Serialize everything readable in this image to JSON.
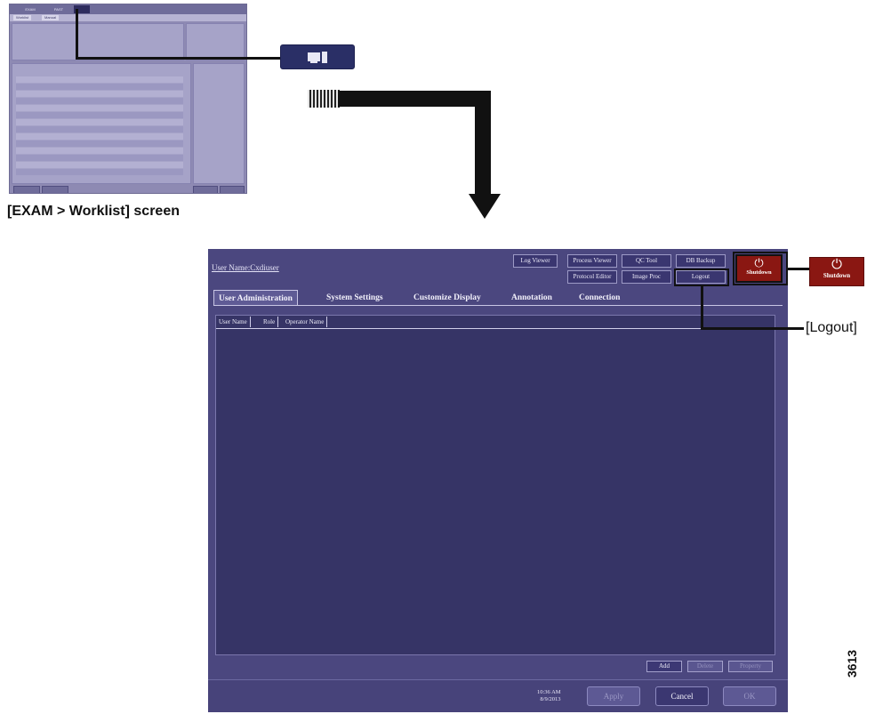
{
  "thumbnail": {
    "tabs": [
      "EXAM",
      "PAST",
      ""
    ],
    "subtabs": [
      "Worklist",
      "Manual"
    ]
  },
  "caption": "[EXAM > Worklist] screen",
  "window": {
    "user_name": "User Name:Cxdiuser",
    "tool_buttons": {
      "log_viewer": "Log Viewer",
      "process_viewer": "Process Viewer",
      "qc_tool": "QC Tool",
      "db_backup": "DB Backup",
      "protocol_editor": "Protocol Editor",
      "image_proc": "Image Proc",
      "logout": "Logout",
      "shutdown": "Shutdown"
    },
    "tabs": [
      "User Administration",
      "System Settings",
      "Customize Display",
      "Annotation",
      "Connection"
    ],
    "active_tab": "User Administration",
    "table": {
      "columns": [
        "User Name",
        "Role",
        "Operator Name"
      ],
      "rows": []
    },
    "grid_buttons": {
      "add": "Add",
      "delete": "Delete",
      "property": "Property"
    },
    "clock": {
      "time": "10:36 AM",
      "date": "8/9/2013"
    },
    "footer_buttons": {
      "apply": "Apply",
      "cancel": "Cancel",
      "ok": "OK"
    }
  },
  "callouts": {
    "shutdown_label": "Shutdown",
    "logout_label": "[Logout]"
  },
  "figure_number": "3613",
  "colors": {
    "window_bg": "#4b477f",
    "grid_bg": "#363466",
    "shutdown_red": "#8a1712"
  }
}
